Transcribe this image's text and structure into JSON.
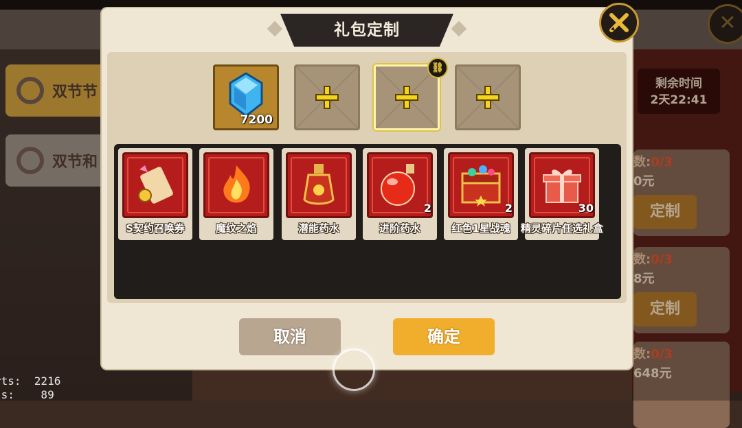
{
  "dialog": {
    "title": "礼包定制",
    "close_icon": "close-crossed-swords-icon"
  },
  "slots": [
    {
      "icon": "blue-diamond-icon",
      "count": "7200"
    },
    {
      "icon": "plus-icon"
    },
    {
      "icon": "plus-icon",
      "selected": true
    },
    {
      "icon": "plus-icon"
    }
  ],
  "link_badge_icon": "link-icon",
  "items": [
    {
      "label": "S契约召唤券",
      "icon": "summon-scroll-icon",
      "count": ""
    },
    {
      "label": "魔纹之焰",
      "icon": "flame-icon",
      "count": ""
    },
    {
      "label": "潜能药水",
      "icon": "potential-potion-icon",
      "count": ""
    },
    {
      "label": "进阶药水",
      "icon": "advance-potion-icon",
      "count": "2"
    },
    {
      "label": "红色1星战魂",
      "icon": "treasure-chest-icon",
      "count": "2"
    },
    {
      "label": "精灵碎片任选礼盒",
      "icon": "gift-box-icon",
      "count": "30"
    }
  ],
  "buttons": {
    "cancel": "取消",
    "confirm": "确定"
  },
  "background": {
    "tabs": [
      "双节节",
      "双节和"
    ],
    "remaining_label": "剩余时间",
    "remaining_value": "2天22:41",
    "cards": [
      {
        "limit_prefix": "数:",
        "limit_value": "0/3",
        "price": "0元",
        "button": "定制"
      },
      {
        "limit_prefix": "数:",
        "limit_value": "0/3",
        "price": "8元",
        "button": "定制"
      },
      {
        "limit_prefix": "数:",
        "limit_value": "0/3",
        "price": "648元",
        "button": ""
      }
    ],
    "debug_lines": [
      "rts:  2216",
      "ls:    89"
    ]
  },
  "colors": {
    "accent_gold": "#f0ae2c",
    "item_red": "#b51d1d",
    "panel_dark": "#211d1a"
  }
}
